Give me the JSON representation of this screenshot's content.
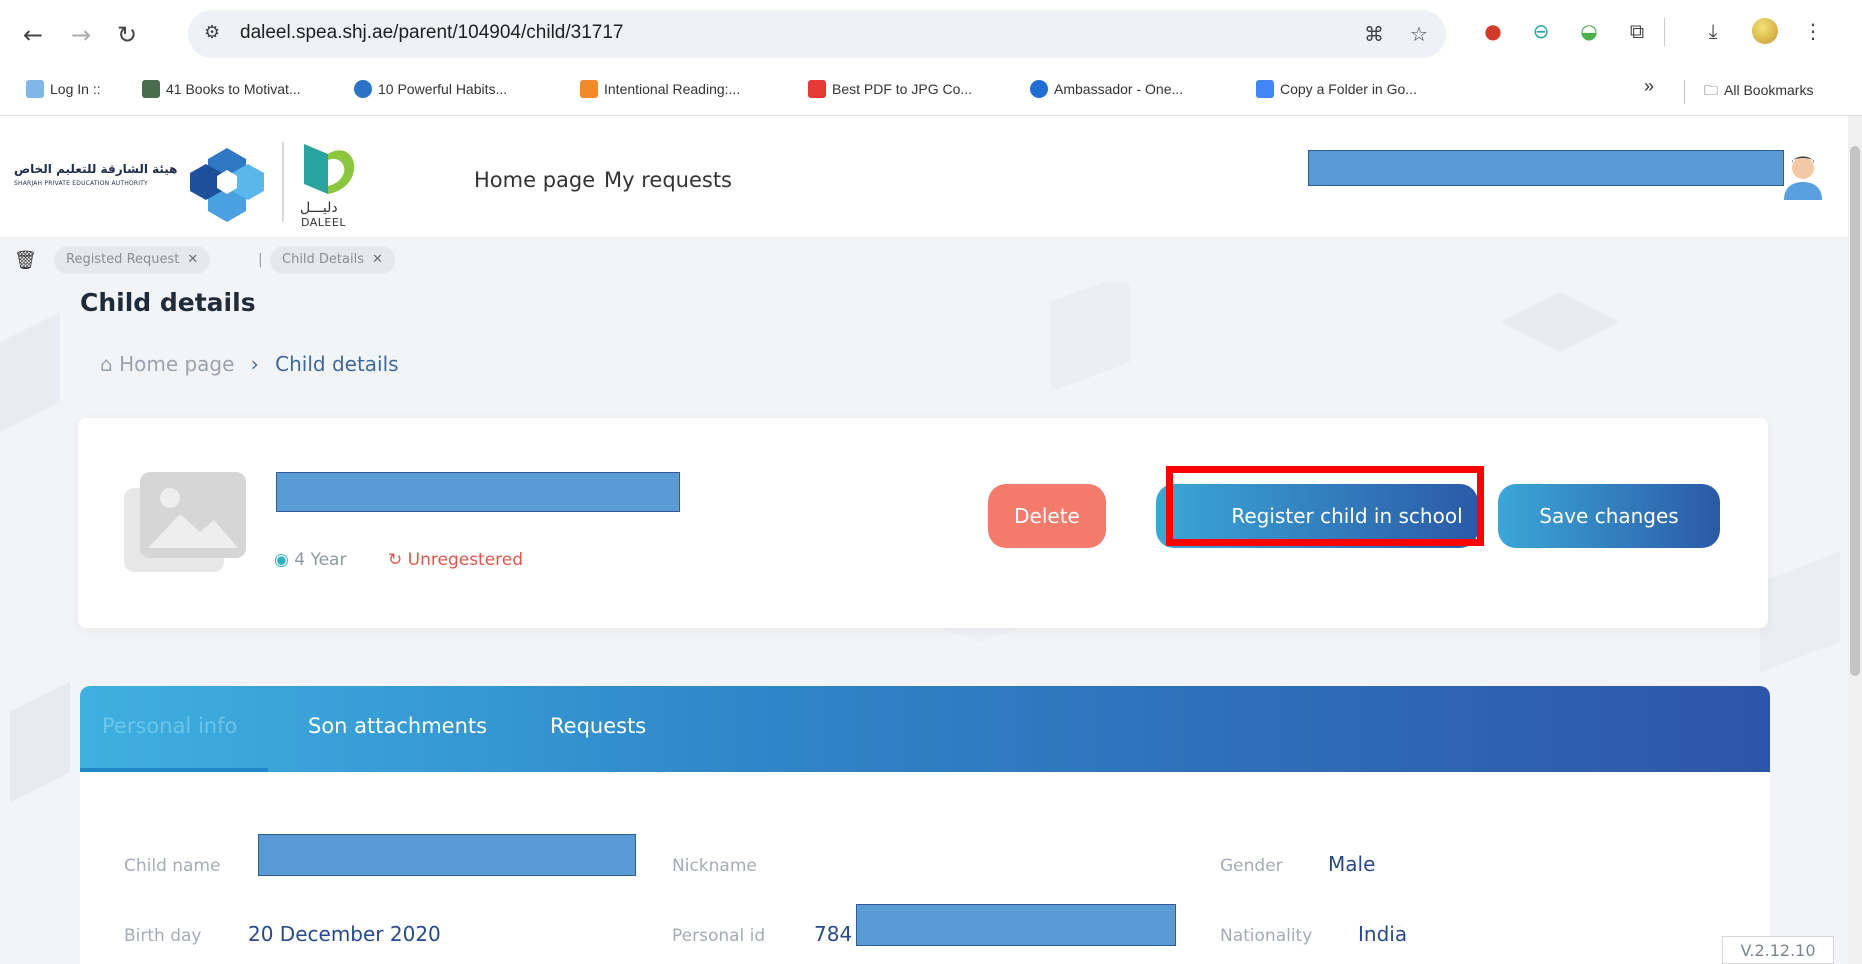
{
  "browser": {
    "url": "daleel.spea.shj.ae/parent/104904/child/31717",
    "bookmarks": [
      {
        "label": "Log In ::",
        "color": "#7fb8e8"
      },
      {
        "label": "41 Books to Motivat...",
        "color": "#4a6b4e"
      },
      {
        "label": "10 Powerful Habits...",
        "color": "#2a73c9"
      },
      {
        "label": "Intentional Reading:...",
        "color": "#f08a2a"
      },
      {
        "label": "Best PDF to JPG Co...",
        "color": "#e53935"
      },
      {
        "label": "Ambassador - One...",
        "color": "#1e6fcf"
      },
      {
        "label": "Copy a Folder in Go...",
        "color": "#4285f4"
      }
    ],
    "more_bookmarks": "»",
    "all_bookmarks": "All Bookmarks"
  },
  "header": {
    "logo_arabic": "هيئة الشارقة للتعليم الخاص",
    "logo_english": "SHARJAH PRIVATE EDUCATION AUTHORITY",
    "daleel_arabic": "دليـــل",
    "daleel_english": "DALEEL",
    "nav": [
      "Home page",
      "My requests"
    ]
  },
  "tab_chips": [
    "Registed Request",
    "Child Details"
  ],
  "page": {
    "title": "Child details",
    "breadcrumb_home": "Home page",
    "breadcrumb_current": "Child details"
  },
  "child": {
    "age": "4 Year",
    "status": "Unregestered",
    "buttons": {
      "delete": "Delete",
      "register": "Register child in school",
      "save": "Save changes"
    }
  },
  "info": {
    "tabs": [
      "Personal info",
      "Son attachments",
      "Requests"
    ],
    "fields": {
      "child_name_label": "Child name",
      "nickname_label": "Nickname",
      "gender_label": "Gender",
      "gender_value": "Male",
      "birthday_label": "Birth day",
      "birthday_value": "20 December 2020",
      "personal_id_label": "Personal id",
      "personal_id_value": "784",
      "nationality_label": "Nationality",
      "nationality_value": "India"
    }
  },
  "version": "V.2.12.10",
  "colors": {
    "accent_red": "#ff0000",
    "delete": "#f47a6c",
    "primary_start": "#3ba7d8",
    "primary_end": "#2b5aa6",
    "redaction": "#5b9bd5"
  }
}
